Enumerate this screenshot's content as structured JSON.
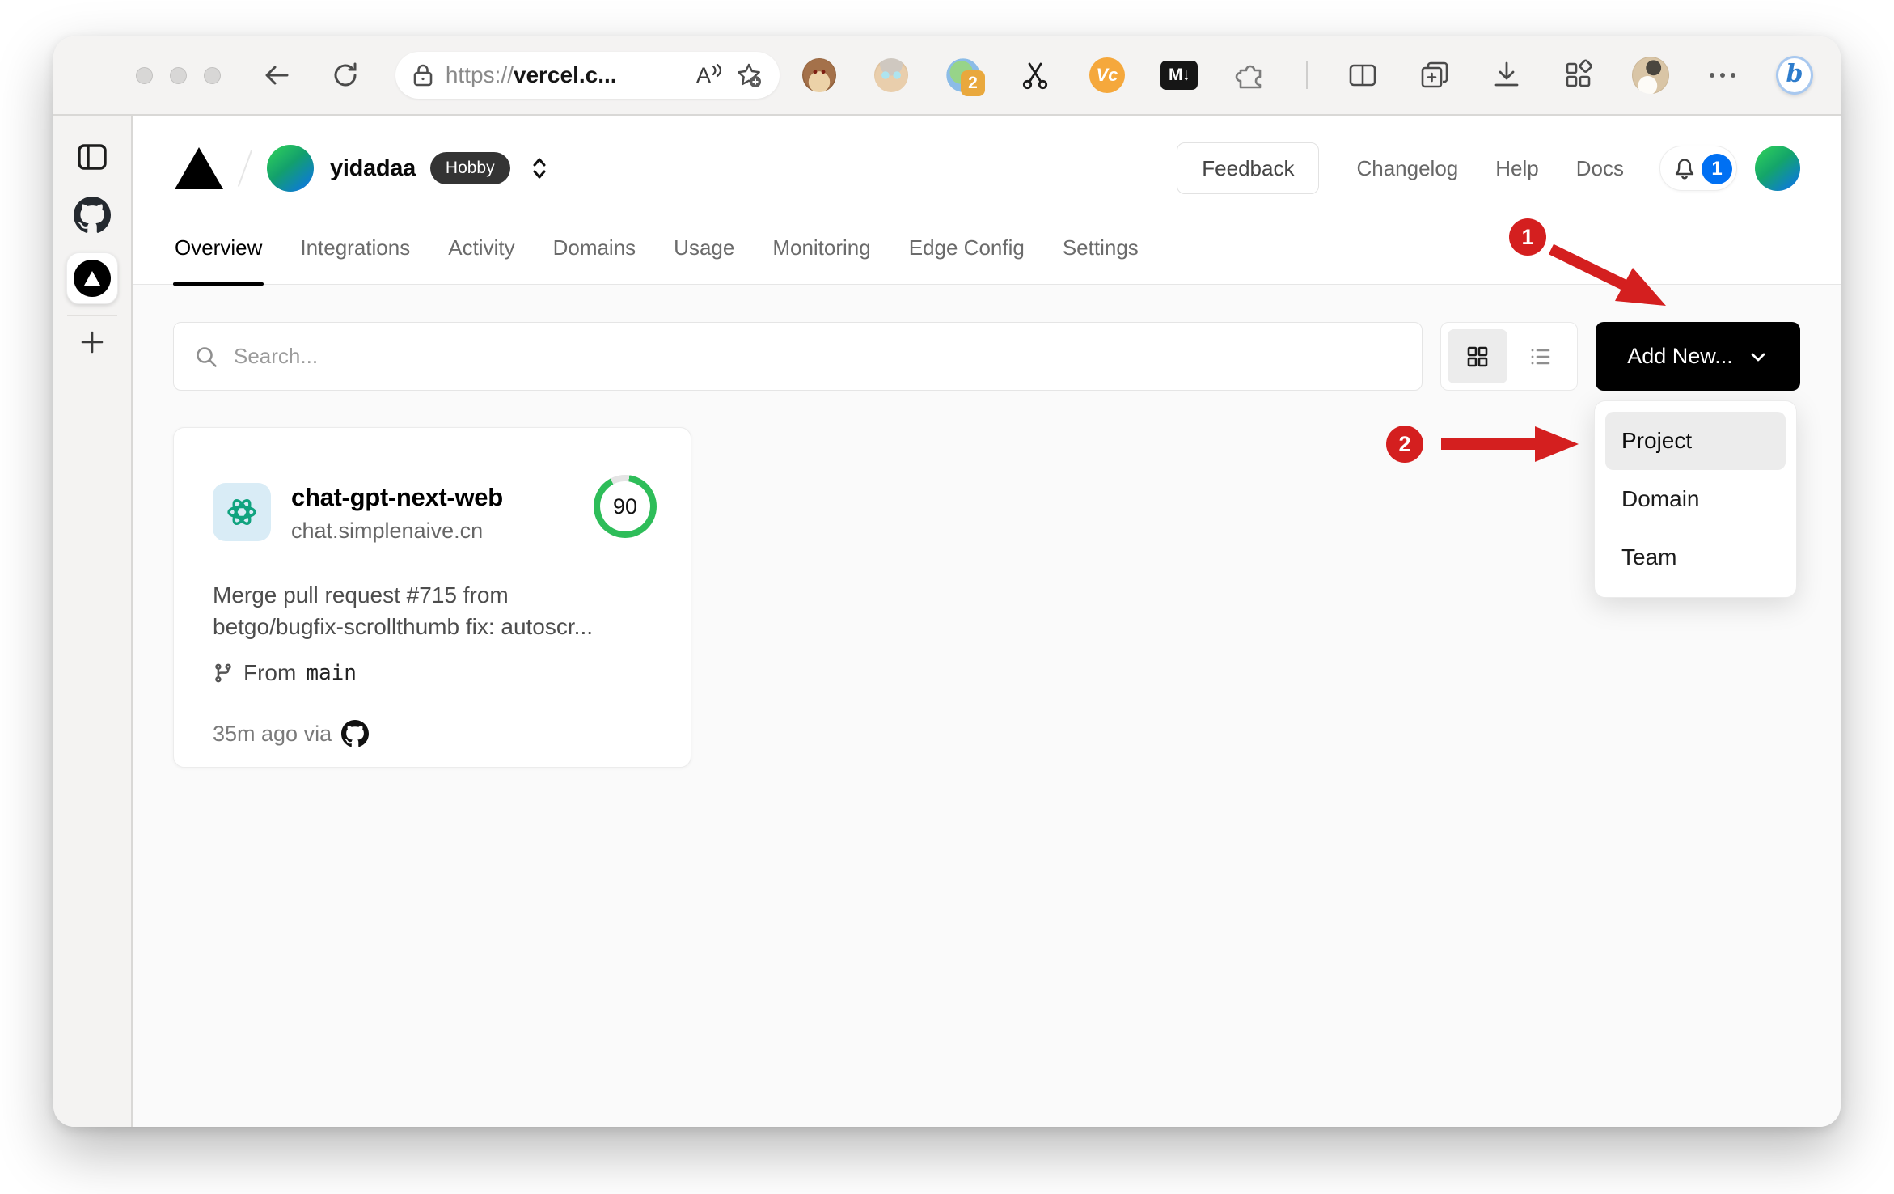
{
  "colors": {
    "annotation_red": "#d41f1f",
    "score_green": "#2ebd59",
    "notification_blue": "#0070f3",
    "openai_teal": "#10a37f",
    "vc_orange": "#f5a83c",
    "tab_badge_orange": "#e9a83d"
  },
  "browser": {
    "url": {
      "scheme": "https://",
      "domain": "vercel.c..."
    },
    "reader_glyph": "A",
    "bing_glyph": "b",
    "extensions": {
      "tab_manager_badge": "2",
      "vc_label": "Vc",
      "markdown_label": "M↓"
    }
  },
  "header": {
    "team_name": "yidadaa",
    "plan_badge": "Hobby",
    "feedback_label": "Feedback",
    "links": [
      {
        "label": "Changelog"
      },
      {
        "label": "Help"
      },
      {
        "label": "Docs"
      }
    ],
    "notification_count": "1"
  },
  "tabs": [
    {
      "label": "Overview"
    },
    {
      "label": "Integrations"
    },
    {
      "label": "Activity"
    },
    {
      "label": "Domains"
    },
    {
      "label": "Usage"
    },
    {
      "label": "Monitoring"
    },
    {
      "label": "Edge Config"
    },
    {
      "label": "Settings"
    }
  ],
  "toolbar": {
    "search_placeholder": "Search...",
    "add_new_label": "Add New..."
  },
  "dropdown": {
    "items": [
      {
        "label": "Project"
      },
      {
        "label": "Domain"
      },
      {
        "label": "Team"
      }
    ]
  },
  "project_card": {
    "name": "chat-gpt-next-web",
    "domain": "chat.simplenaive.cn",
    "score": "90",
    "commit_line1": "Merge pull request #715 from",
    "commit_line2": "betgo/bugfix-scrollthumb fix: autoscr...",
    "branch_prefix": "From",
    "branch_name": "main",
    "deploy_meta": "35m ago via"
  },
  "annotations": {
    "step1": "1",
    "step2": "2"
  }
}
